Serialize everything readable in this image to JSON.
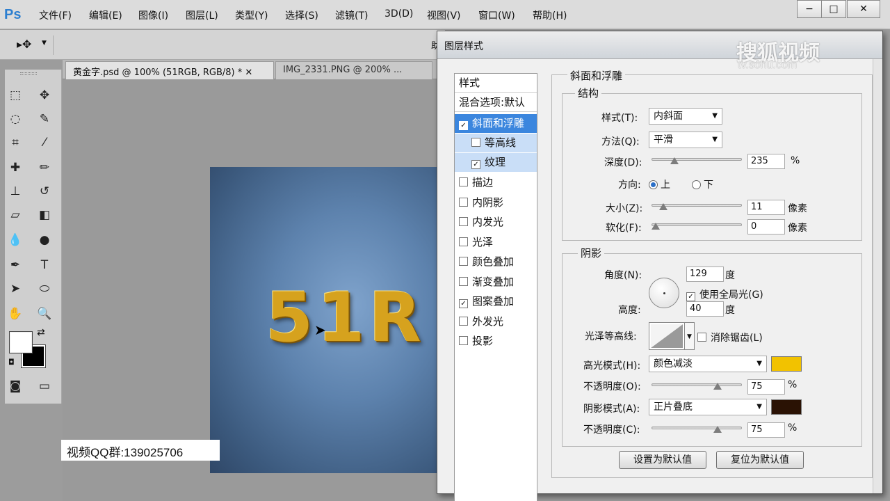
{
  "app": {
    "logo": "Ps",
    "menu": [
      "文件(F)",
      "编辑(E)",
      "图像(I)",
      "图层(L)",
      "类型(Y)",
      "选择(S)",
      "滤镜(T)",
      "3D(D)",
      "视图(V)",
      "窗口(W)",
      "帮助(H)"
    ],
    "window_buttons": {
      "minimize": "−",
      "maximize": "□",
      "close": "✕"
    }
  },
  "options_bar": {
    "partial_text": "助"
  },
  "tabs": [
    {
      "label": "黄金字.psd @ 100% (51RGB, RGB/8) * ✕"
    },
    {
      "label": "IMG_2331.PNG @ 200% ..."
    }
  ],
  "canvas": {
    "text": "51R",
    "qq_badge": "视频QQ群:139025706"
  },
  "watermark": {
    "brand": "搜狐视频",
    "url": "tv.sohu.com"
  },
  "dialog": {
    "title": "图层样式",
    "style_list": [
      {
        "label": "样式",
        "kind": "header"
      },
      {
        "label": "混合选项:默认",
        "kind": "header"
      },
      {
        "label": "斜面和浮雕",
        "checked": true,
        "kind": "selected"
      },
      {
        "label": "等高线",
        "checked": false,
        "kind": "sub"
      },
      {
        "label": "纹理",
        "checked": true,
        "kind": "sub"
      },
      {
        "label": "描边",
        "checked": false
      },
      {
        "label": "内阴影",
        "checked": false
      },
      {
        "label": "内发光",
        "checked": false
      },
      {
        "label": "光泽",
        "checked": false
      },
      {
        "label": "颜色叠加",
        "checked": false
      },
      {
        "label": "渐变叠加",
        "checked": false
      },
      {
        "label": "图案叠加",
        "checked": true
      },
      {
        "label": "外发光",
        "checked": false
      },
      {
        "label": "投影",
        "checked": false
      }
    ],
    "bevel": {
      "section_title": "斜面和浮雕",
      "structure_title": "结构",
      "style_label": "样式(T):",
      "style_value": "内斜面",
      "technique_label": "方法(Q):",
      "technique_value": "平滑",
      "depth_label": "深度(D):",
      "depth_value": "235",
      "depth_unit": "%",
      "depth_slider": 0.23,
      "direction_label": "方向:",
      "dir_up": "上",
      "dir_down": "下",
      "direction_selected": "上",
      "size_label": "大小(Z):",
      "size_value": "11",
      "size_unit": "像素",
      "size_slider": 0.09,
      "soften_label": "软化(F):",
      "soften_value": "0",
      "soften_unit": "像素",
      "soften_slider": 0.0
    },
    "shading": {
      "section_title": "阴影",
      "angle_label": "角度(N):",
      "angle_value": "129",
      "angle_unit": "度",
      "global_light_label": "使用全局光(G)",
      "global_light_checked": true,
      "altitude_label": "高度:",
      "altitude_value": "40",
      "altitude_unit": "度",
      "gloss_contour_label": "光泽等高线:",
      "anti_alias_label": "消除锯齿(L)",
      "anti_alias_checked": false,
      "highlight_label": "高光模式(H):",
      "highlight_value": "颜色减淡",
      "highlight_color": "#f2c200",
      "hl_opacity_label": "不透明度(O):",
      "hl_opacity_value": "75",
      "hl_opacity_unit": "%",
      "hl_opacity_slider": 0.75,
      "shadow_label": "阴影模式(A):",
      "shadow_value": "正片叠底",
      "shadow_color": "#2a1204",
      "sh_opacity_label": "不透明度(C):",
      "sh_opacity_value": "75",
      "sh_opacity_unit": "%",
      "sh_opacity_slider": 0.75
    },
    "buttons": {
      "make_default": "设置为默认值",
      "reset_default": "复位为默认值"
    }
  }
}
